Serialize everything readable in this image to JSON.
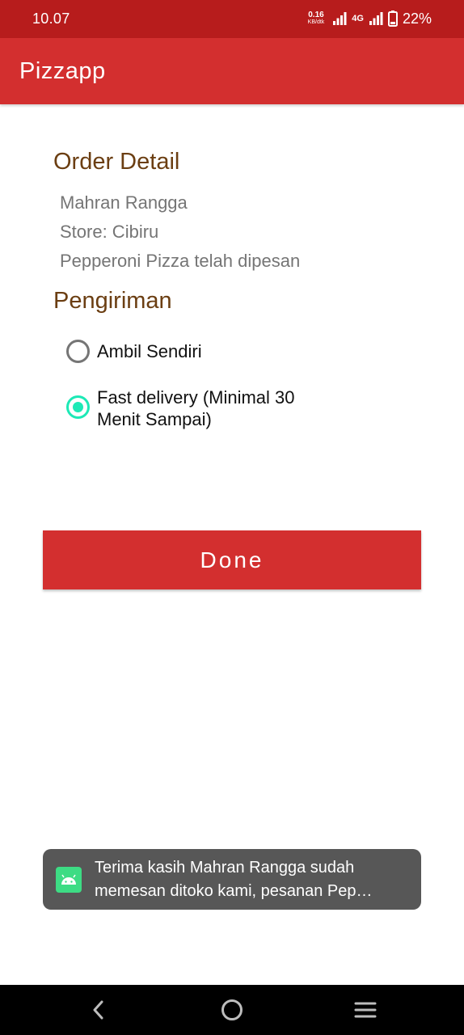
{
  "status_bar": {
    "time": "10.07",
    "net_speed_value": "0.16",
    "net_speed_unit": "KB/dtk",
    "network_type": "4G",
    "battery": "22%"
  },
  "app_bar": {
    "title": "Pizzapp"
  },
  "order_detail": {
    "title": "Order Detail",
    "customer_name": "Mahran Rangga",
    "store": "Store: Cibiru",
    "ordered_item": "Pepperoni Pizza telah dipesan"
  },
  "delivery": {
    "title": "Pengiriman",
    "options": [
      {
        "label": "Ambil Sendiri",
        "checked": false
      },
      {
        "label": "Fast delivery (Minimal 30 Menit Sampai)",
        "checked": true
      }
    ]
  },
  "done_button": {
    "label": "Done"
  },
  "toast": {
    "line1": "Terima kasih Mahran Rangga sudah",
    "line2": "memesan ditoko kami, pesanan Pep…"
  },
  "colors": {
    "status_bar": "#b71c1c",
    "app_bar": "#d32f2f",
    "section_title": "#6b3e12",
    "radio_accent": "#1de9b6",
    "toast_bg": "#575757"
  },
  "icons": [
    "signal-icon",
    "battery-icon",
    "android-app-icon",
    "back-icon",
    "home-icon",
    "recents-icon"
  ]
}
